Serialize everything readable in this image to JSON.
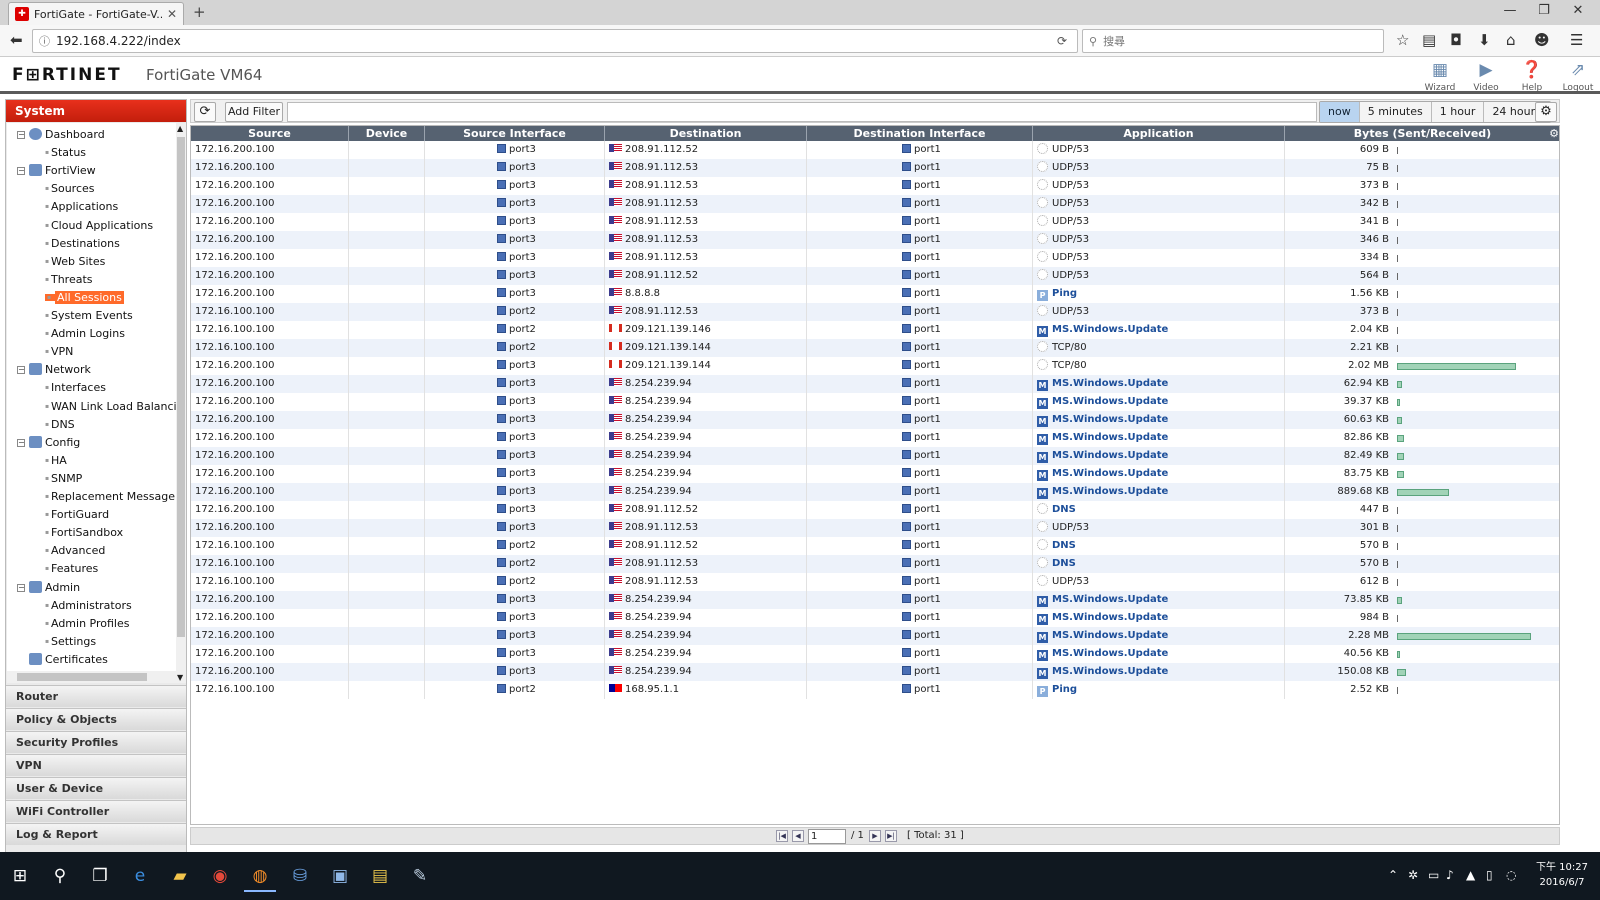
{
  "browser": {
    "tab_title": "FortiGate - FortiGate-V...",
    "new_tab": "+",
    "url": "192.168.4.222/index",
    "search_placeholder": "搜尋"
  },
  "header": {
    "brand": "F⊞RTINET",
    "device": "FortiGate VM64",
    "buttons": [
      "Wizard",
      "Video",
      "Help",
      "Logout"
    ]
  },
  "sidebar": {
    "section": "System",
    "tree": [
      {
        "label": "Dashboard",
        "level": 0,
        "icon": "dashboard-icon"
      },
      {
        "label": "Status",
        "level": 1
      },
      {
        "label": "FortiView",
        "level": 0,
        "icon": "fortiview-icon"
      },
      {
        "label": "Sources",
        "level": 1
      },
      {
        "label": "Applications",
        "level": 1
      },
      {
        "label": "Cloud Applications",
        "level": 1
      },
      {
        "label": "Destinations",
        "level": 1
      },
      {
        "label": "Web Sites",
        "level": 1
      },
      {
        "label": "Threats",
        "level": 1
      },
      {
        "label": "All Sessions",
        "level": 1,
        "selected": true
      },
      {
        "label": "System Events",
        "level": 1
      },
      {
        "label": "Admin Logins",
        "level": 1
      },
      {
        "label": "VPN",
        "level": 1
      },
      {
        "label": "Network",
        "level": 0,
        "icon": "network-icon"
      },
      {
        "label": "Interfaces",
        "level": 1
      },
      {
        "label": "WAN Link Load Balanci",
        "level": 1
      },
      {
        "label": "DNS",
        "level": 1
      },
      {
        "label": "Config",
        "level": 0,
        "icon": "config-icon"
      },
      {
        "label": "HA",
        "level": 1
      },
      {
        "label": "SNMP",
        "level": 1
      },
      {
        "label": "Replacement Message",
        "level": 1
      },
      {
        "label": "FortiGuard",
        "level": 1
      },
      {
        "label": "FortiSandbox",
        "level": 1
      },
      {
        "label": "Advanced",
        "level": 1
      },
      {
        "label": "Features",
        "level": 1
      },
      {
        "label": "Admin",
        "level": 0,
        "icon": "admin-icon"
      },
      {
        "label": "Administrators",
        "level": 1
      },
      {
        "label": "Admin Profiles",
        "level": 1
      },
      {
        "label": "Settings",
        "level": 1
      },
      {
        "label": "Certificates",
        "level": 0,
        "icon": "certificates-icon"
      }
    ],
    "menus": [
      "Router",
      "Policy & Objects",
      "Security Profiles",
      "VPN",
      "User & Device",
      "WiFi Controller",
      "Log & Report"
    ]
  },
  "toolbar": {
    "add_filter": "Add Filter",
    "time_options": [
      "now",
      "5 minutes",
      "1 hour",
      "24 hours"
    ],
    "active_time": "now"
  },
  "table": {
    "columns": [
      "Source",
      "Device",
      "Source Interface",
      "Destination",
      "Destination Interface",
      "Application",
      "Bytes (Sent/Received)"
    ],
    "rows": [
      {
        "src": "172.16.200.100",
        "sif": "port3",
        "flag": "us",
        "dst": "208.91.112.52",
        "dif": "port1",
        "app": "UDP/53",
        "apptype": "gen",
        "bytes": "609 B",
        "bar": 0.01
      },
      {
        "src": "172.16.200.100",
        "sif": "port3",
        "flag": "us",
        "dst": "208.91.112.53",
        "dif": "port1",
        "app": "UDP/53",
        "apptype": "gen",
        "bytes": "75 B",
        "bar": 0.01
      },
      {
        "src": "172.16.200.100",
        "sif": "port3",
        "flag": "us",
        "dst": "208.91.112.53",
        "dif": "port1",
        "app": "UDP/53",
        "apptype": "gen",
        "bytes": "373 B",
        "bar": 0.01
      },
      {
        "src": "172.16.200.100",
        "sif": "port3",
        "flag": "us",
        "dst": "208.91.112.53",
        "dif": "port1",
        "app": "UDP/53",
        "apptype": "gen",
        "bytes": "342 B",
        "bar": 0.01
      },
      {
        "src": "172.16.200.100",
        "sif": "port3",
        "flag": "us",
        "dst": "208.91.112.53",
        "dif": "port1",
        "app": "UDP/53",
        "apptype": "gen",
        "bytes": "341 B",
        "bar": 0.01
      },
      {
        "src": "172.16.200.100",
        "sif": "port3",
        "flag": "us",
        "dst": "208.91.112.53",
        "dif": "port1",
        "app": "UDP/53",
        "apptype": "gen",
        "bytes": "346 B",
        "bar": 0.01
      },
      {
        "src": "172.16.200.100",
        "sif": "port3",
        "flag": "us",
        "dst": "208.91.112.53",
        "dif": "port1",
        "app": "UDP/53",
        "apptype": "gen",
        "bytes": "334 B",
        "bar": 0.01
      },
      {
        "src": "172.16.200.100",
        "sif": "port3",
        "flag": "us",
        "dst": "208.91.112.52",
        "dif": "port1",
        "app": "UDP/53",
        "apptype": "gen",
        "bytes": "564 B",
        "bar": 0.01
      },
      {
        "src": "172.16.200.100",
        "sif": "port3",
        "flag": "us",
        "dst": "8.8.8.8",
        "dif": "port1",
        "app": "Ping",
        "apptype": "ping",
        "bytes": "1.56 KB",
        "bar": 0.01
      },
      {
        "src": "172.16.100.100",
        "sif": "port2",
        "flag": "us",
        "dst": "208.91.112.53",
        "dif": "port1",
        "app": "UDP/53",
        "apptype": "gen",
        "bytes": "373 B",
        "bar": 0.01
      },
      {
        "src": "172.16.100.100",
        "sif": "port2",
        "flag": "ca",
        "dst": "209.121.139.146",
        "dif": "port1",
        "app": "MS.Windows.Update",
        "apptype": "ms",
        "bytes": "2.04 KB",
        "bar": 0.01
      },
      {
        "src": "172.16.100.100",
        "sif": "port2",
        "flag": "ca",
        "dst": "209.121.139.144",
        "dif": "port1",
        "app": "TCP/80",
        "apptype": "gen",
        "bytes": "2.21 KB",
        "bar": 0.01
      },
      {
        "src": "172.16.200.100",
        "sif": "port3",
        "flag": "ca",
        "dst": "209.121.139.144",
        "dif": "port1",
        "app": "TCP/80",
        "apptype": "gen",
        "bytes": "2.02 MB",
        "bar": 0.89
      },
      {
        "src": "172.16.200.100",
        "sif": "port3",
        "flag": "us",
        "dst": "8.254.239.94",
        "dif": "port1",
        "app": "MS.Windows.Update",
        "apptype": "ms",
        "bytes": "62.94 KB",
        "bar": 0.04
      },
      {
        "src": "172.16.200.100",
        "sif": "port3",
        "flag": "us",
        "dst": "8.254.239.94",
        "dif": "port1",
        "app": "MS.Windows.Update",
        "apptype": "ms",
        "bytes": "39.37 KB",
        "bar": 0.02
      },
      {
        "src": "172.16.200.100",
        "sif": "port3",
        "flag": "us",
        "dst": "8.254.239.94",
        "dif": "port1",
        "app": "MS.Windows.Update",
        "apptype": "ms",
        "bytes": "60.63 KB",
        "bar": 0.04
      },
      {
        "src": "172.16.200.100",
        "sif": "port3",
        "flag": "us",
        "dst": "8.254.239.94",
        "dif": "port1",
        "app": "MS.Windows.Update",
        "apptype": "ms",
        "bytes": "82.86 KB",
        "bar": 0.05
      },
      {
        "src": "172.16.200.100",
        "sif": "port3",
        "flag": "us",
        "dst": "8.254.239.94",
        "dif": "port1",
        "app": "MS.Windows.Update",
        "apptype": "ms",
        "bytes": "82.49 KB",
        "bar": 0.05
      },
      {
        "src": "172.16.200.100",
        "sif": "port3",
        "flag": "us",
        "dst": "8.254.239.94",
        "dif": "port1",
        "app": "MS.Windows.Update",
        "apptype": "ms",
        "bytes": "83.75 KB",
        "bar": 0.05
      },
      {
        "src": "172.16.200.100",
        "sif": "port3",
        "flag": "us",
        "dst": "8.254.239.94",
        "dif": "port1",
        "app": "MS.Windows.Update",
        "apptype": "ms",
        "bytes": "889.68 KB",
        "bar": 0.39
      },
      {
        "src": "172.16.200.100",
        "sif": "port3",
        "flag": "us",
        "dst": "208.91.112.52",
        "dif": "port1",
        "app": "DNS",
        "apptype": "gen",
        "bytes": "447 B",
        "bar": 0.01
      },
      {
        "src": "172.16.200.100",
        "sif": "port3",
        "flag": "us",
        "dst": "208.91.112.53",
        "dif": "port1",
        "app": "UDP/53",
        "apptype": "gen",
        "bytes": "301 B",
        "bar": 0.01
      },
      {
        "src": "172.16.100.100",
        "sif": "port2",
        "flag": "us",
        "dst": "208.91.112.52",
        "dif": "port1",
        "app": "DNS",
        "apptype": "gen",
        "bytes": "570 B",
        "bar": 0.01
      },
      {
        "src": "172.16.100.100",
        "sif": "port2",
        "flag": "us",
        "dst": "208.91.112.53",
        "dif": "port1",
        "app": "DNS",
        "apptype": "gen",
        "bytes": "570 B",
        "bar": 0.01
      },
      {
        "src": "172.16.100.100",
        "sif": "port2",
        "flag": "us",
        "dst": "208.91.112.53",
        "dif": "port1",
        "app": "UDP/53",
        "apptype": "gen",
        "bytes": "612 B",
        "bar": 0.01
      },
      {
        "src": "172.16.200.100",
        "sif": "port3",
        "flag": "us",
        "dst": "8.254.239.94",
        "dif": "port1",
        "app": "MS.Windows.Update",
        "apptype": "ms",
        "bytes": "73.85 KB",
        "bar": 0.04
      },
      {
        "src": "172.16.200.100",
        "sif": "port3",
        "flag": "us",
        "dst": "8.254.239.94",
        "dif": "port1",
        "app": "MS.Windows.Update",
        "apptype": "ms",
        "bytes": "984 B",
        "bar": 0.01
      },
      {
        "src": "172.16.200.100",
        "sif": "port3",
        "flag": "us",
        "dst": "8.254.239.94",
        "dif": "port1",
        "app": "MS.Windows.Update",
        "apptype": "ms",
        "bytes": "2.28 MB",
        "bar": 1.0
      },
      {
        "src": "172.16.200.100",
        "sif": "port3",
        "flag": "us",
        "dst": "8.254.239.94",
        "dif": "port1",
        "app": "MS.Windows.Update",
        "apptype": "ms",
        "bytes": "40.56 KB",
        "bar": 0.02
      },
      {
        "src": "172.16.200.100",
        "sif": "port3",
        "flag": "us",
        "dst": "8.254.239.94",
        "dif": "port1",
        "app": "MS.Windows.Update",
        "apptype": "ms",
        "bytes": "150.08 KB",
        "bar": 0.07
      },
      {
        "src": "172.16.100.100",
        "sif": "port2",
        "flag": "tw",
        "dst": "168.95.1.1",
        "dif": "port1",
        "app": "Ping",
        "apptype": "ping",
        "bytes": "2.52 KB",
        "bar": 0.01
      }
    ]
  },
  "pager": {
    "page": "1",
    "of": "/ 1",
    "total": "[ Total: 31 ]"
  },
  "taskbar": {
    "time": "下午 10:27",
    "date": "2016/6/7"
  },
  "colors": {
    "accent": "#d92a15",
    "header_row": "#566271",
    "selected": "#ff6a2a",
    "bar": "#a1d3b7"
  }
}
